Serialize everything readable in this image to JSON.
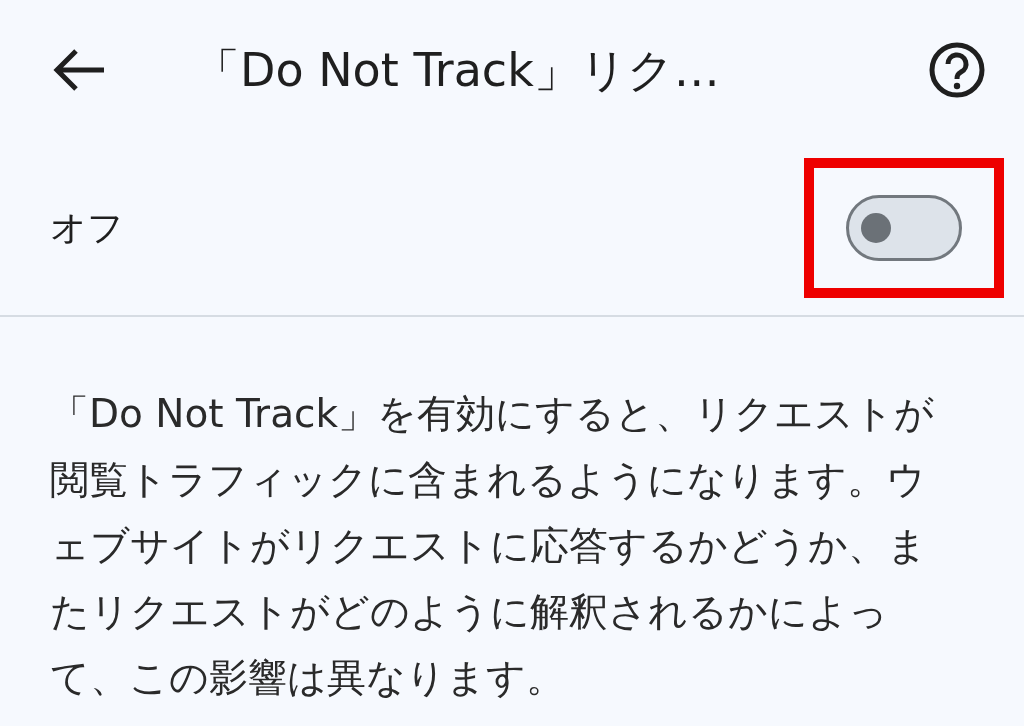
{
  "header": {
    "title": "「Do Not Track」リク…"
  },
  "setting": {
    "label": "オフ",
    "on": false,
    "highlighted": true
  },
  "description": "「Do Not Track」を有効にすると、リクエストが閲覧トラフィックに含まれるようになります。ウェブサイトがリクエストに応答するかどうか、またリクエストがどのように解釈されるかによって、この影響は異なります。"
}
